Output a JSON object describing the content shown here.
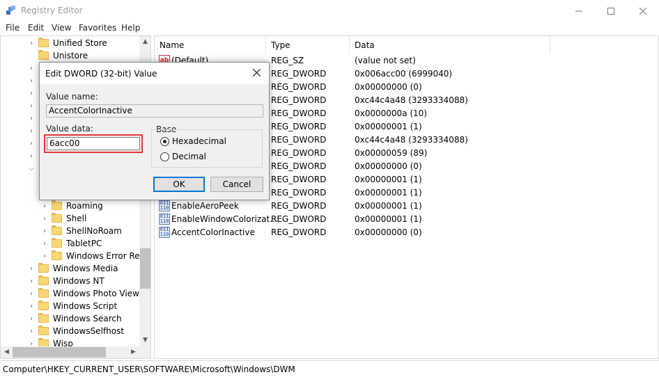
{
  "window": {
    "title": "Registry Editor"
  },
  "menu": [
    "File",
    "Edit",
    "View",
    "Favorites",
    "Help"
  ],
  "tree": [
    {
      "label": "Unified Store",
      "indent": 0
    },
    {
      "label": "Unistore",
      "indent": 0
    },
    {
      "label": "Roaming",
      "indent": 1
    },
    {
      "label": "Shell",
      "indent": 1
    },
    {
      "label": "ShellNoRoam",
      "indent": 1
    },
    {
      "label": "TabletPC",
      "indent": 1
    },
    {
      "label": "Windows Error Repo",
      "indent": 1
    },
    {
      "label": "Windows Media",
      "indent": 0
    },
    {
      "label": "Windows NT",
      "indent": 0
    },
    {
      "label": "Windows Photo Viewer",
      "indent": 0
    },
    {
      "label": "Windows Script",
      "indent": 0
    },
    {
      "label": "Windows Search",
      "indent": 0
    },
    {
      "label": "WindowsSelfhost",
      "indent": 0
    },
    {
      "label": "Wisp",
      "indent": 0
    }
  ],
  "columns": {
    "name": "Name",
    "type": "Type",
    "data": "Data"
  },
  "values": [
    {
      "name": "(Default)",
      "type": "REG_SZ",
      "data": "(value not set)"
    },
    {
      "name": "",
      "type": "REG_DWORD",
      "data": "0x006acc00 (6999040)"
    },
    {
      "name": "",
      "type": "REG_DWORD",
      "data": "0x00000000 (0)"
    },
    {
      "name": "",
      "type": "REG_DWORD",
      "data": "0xc44c4a48 (3293334088)"
    },
    {
      "name": "",
      "type": "REG_DWORD",
      "data": "0x0000000a (10)"
    },
    {
      "name": "",
      "type": "REG_DWORD",
      "data": "0x00000001 (1)"
    },
    {
      "name": "",
      "type": "REG_DWORD",
      "data": "0xc44c4a48 (3293334088)"
    },
    {
      "name": "",
      "type": "REG_DWORD",
      "data": "0x00000059 (89)"
    },
    {
      "name": "",
      "type": "REG_DWORD",
      "data": "0x00000000 (0)"
    },
    {
      "name": "",
      "type": "REG_DWORD",
      "data": "0x00000001 (1)"
    },
    {
      "name": "",
      "type": "REG_DWORD",
      "data": "0x00000001 (1)"
    },
    {
      "name": "EnableAeroPeek",
      "type": "REG_DWORD",
      "data": "0x00000001 (1)"
    },
    {
      "name": "EnableWindowColorizat...",
      "type": "REG_DWORD",
      "data": "0x00000001 (1)"
    },
    {
      "name": "AccentColorInactive",
      "type": "REG_DWORD",
      "data": "0x00000000 (0)"
    }
  ],
  "status": "Computer\\HKEY_CURRENT_USER\\SOFTWARE\\Microsoft\\Windows\\DWM",
  "dialog": {
    "title": "Edit DWORD (32-bit) Value",
    "value_name_label": "Value name:",
    "value_name": "AccentColorInactive",
    "value_data_label": "Value data:",
    "value_data": "6acc00",
    "base_label": "Base",
    "hex_label": "Hexadecimal",
    "dec_label": "Decimal",
    "base_selected": "Hexadecimal",
    "ok_label": "OK",
    "cancel_label": "Cancel"
  },
  "colors": {
    "highlight": "#e03a3a",
    "default_button": "#0078d7"
  }
}
